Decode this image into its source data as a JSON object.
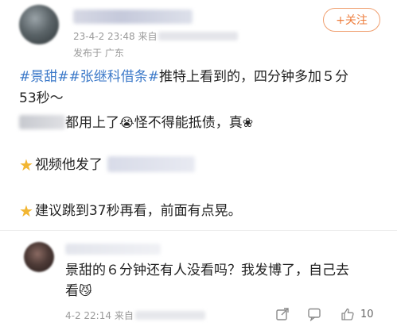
{
  "post": {
    "timestamp": "23-4-2 23:48",
    "source_prefix": "来自",
    "location": "发布于 广东",
    "follow_label": "+关注",
    "line1_tags": "#景甜##张继科借条#",
    "line1_text": "推特上看到的，四分钟多加５分",
    "line2": "53秒～",
    "line3_text": "都用上了",
    "line3_emoji": "😭",
    "line3_text2": "怪不得能抵债，真",
    "line3_emoji2": "❀",
    "line4_text": "视频他发了",
    "line5_text": "建议跳到37秒再看，前面有点晃。",
    "star_icon": "star-icon"
  },
  "comment": {
    "line1": "景甜的６分钟还有人没看吗？我发博了，自己去",
    "line2": "看",
    "line2_emoji": "😼",
    "timestamp": "4-2 22:14",
    "source_prefix": "来自",
    "like_count": "10"
  },
  "colors": {
    "hashtag": "#3d7ac9",
    "follow": "#ee7d3c",
    "star": "#f2b632",
    "meta": "#9a9a9a"
  }
}
